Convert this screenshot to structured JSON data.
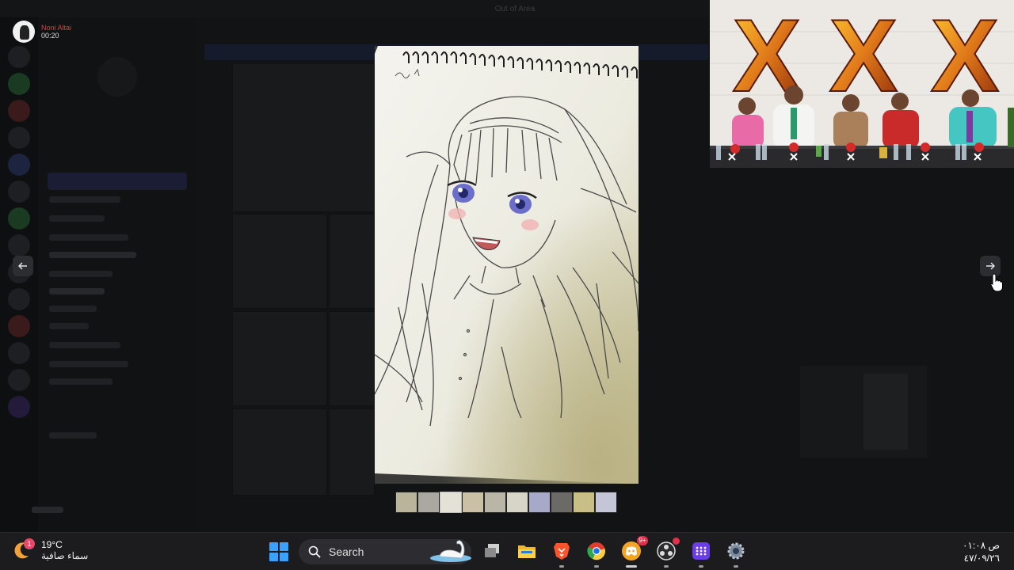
{
  "window": {
    "title": "Out of Area"
  },
  "caller": {
    "name": "Noni Altai",
    "duration": "00:20"
  },
  "viewer": {
    "prev_icon": "arrow-left-icon",
    "next_icon": "arrow-right-icon",
    "thumbnail_count": 10,
    "thumbnail_colors": [
      "#b8b59a",
      "#a9a9a2",
      "#e4e2d6",
      "#c9c0a6",
      "#b9b6a8",
      "#d7d4c8",
      "#a6aac8",
      "#6b6a66",
      "#c8bf86",
      "#c4c6d8"
    ]
  },
  "stream": {
    "backdrop_letters": [
      "X",
      "X",
      "X"
    ]
  },
  "taskbar": {
    "weather": {
      "temperature": "19°C",
      "description": "سماء صافية",
      "badge": "1"
    },
    "search": {
      "label": "Search"
    },
    "discord_badge": "9+",
    "clock": {
      "time": "ص ٠١:٠٨",
      "date": "٤٧/٠٩/٢٦"
    }
  },
  "colors": {
    "accent": "#5865f2",
    "taskbar": "#1c1c1f",
    "badge": "#e0304a"
  }
}
